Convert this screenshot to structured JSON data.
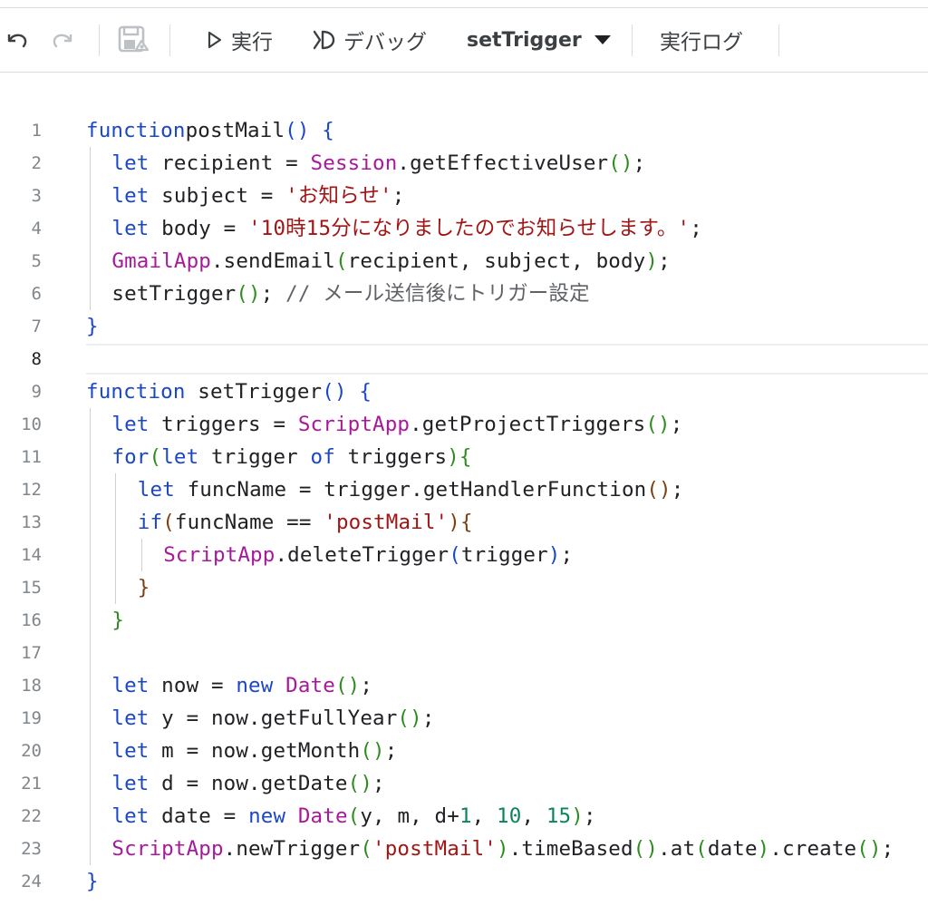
{
  "toolbar": {
    "undo_icon": "undo-icon",
    "redo_icon": "redo-icon",
    "save_icon": "save-icon",
    "run_label": "実行",
    "debug_label": "デバッグ",
    "function_selector": "setTrigger",
    "log_label": "実行ログ"
  },
  "editor": {
    "current_line": 8,
    "lines": [
      {
        "n": "1",
        "indent": 0,
        "tokens": [
          [
            "kw",
            "function"
          ],
          [
            "",
            "postMail"
          ],
          [
            "b0",
            "()"
          ],
          [
            "",
            " "
          ],
          [
            "b0",
            "{"
          ]
        ]
      },
      {
        "n": "2",
        "indent": 1,
        "tokens": [
          [
            "kw",
            "let"
          ],
          [
            "",
            " recipient = "
          ],
          [
            "cls",
            "Session"
          ],
          [
            "",
            ".getEffectiveUser"
          ],
          [
            "b1",
            "()"
          ],
          [
            "",
            ";"
          ]
        ]
      },
      {
        "n": "3",
        "indent": 1,
        "tokens": [
          [
            "kw",
            "let"
          ],
          [
            "",
            " subject = "
          ],
          [
            "str",
            "'お知らせ'"
          ],
          [
            "",
            ";"
          ]
        ]
      },
      {
        "n": "4",
        "indent": 1,
        "tokens": [
          [
            "kw",
            "let"
          ],
          [
            "",
            " body = "
          ],
          [
            "str",
            "'10時15分になりましたのでお知らせします。'"
          ],
          [
            "",
            ";"
          ]
        ]
      },
      {
        "n": "5",
        "indent": 1,
        "tokens": [
          [
            "cls",
            "GmailApp"
          ],
          [
            "",
            ".sendEmail"
          ],
          [
            "b1",
            "("
          ],
          [
            "",
            "recipient, subject, body"
          ],
          [
            "b1",
            ")"
          ],
          [
            "",
            ";"
          ]
        ]
      },
      {
        "n": "6",
        "indent": 1,
        "tokens": [
          [
            "",
            "setTrigger"
          ],
          [
            "b1",
            "()"
          ],
          [
            "",
            "; "
          ],
          [
            "cmt",
            "// メール送信後にトリガー設定"
          ]
        ]
      },
      {
        "n": "7",
        "indent": 0,
        "tokens": [
          [
            "b0",
            "}"
          ]
        ]
      },
      {
        "n": "8",
        "indent": 0,
        "tokens": []
      },
      {
        "n": "9",
        "indent": 0,
        "tokens": [
          [
            "kw",
            "function"
          ],
          [
            "",
            " setTrigger"
          ],
          [
            "b0",
            "()"
          ],
          [
            "",
            " "
          ],
          [
            "b0",
            "{"
          ]
        ]
      },
      {
        "n": "10",
        "indent": 1,
        "tokens": [
          [
            "kw",
            "let"
          ],
          [
            "",
            " triggers = "
          ],
          [
            "cls",
            "ScriptApp"
          ],
          [
            "",
            ".getProjectTriggers"
          ],
          [
            "b1",
            "()"
          ],
          [
            "",
            ";"
          ]
        ]
      },
      {
        "n": "11",
        "indent": 1,
        "tokens": [
          [
            "kw",
            "for"
          ],
          [
            "b1",
            "("
          ],
          [
            "kw",
            "let"
          ],
          [
            "",
            " trigger "
          ],
          [
            "kw",
            "of"
          ],
          [
            "",
            " triggers"
          ],
          [
            "b1",
            ")"
          ],
          [
            "b1",
            "{"
          ]
        ]
      },
      {
        "n": "12",
        "indent": 2,
        "tokens": [
          [
            "kw",
            "let"
          ],
          [
            "",
            " funcName = trigger.getHandlerFunction"
          ],
          [
            "b2",
            "()"
          ],
          [
            "",
            ";"
          ]
        ]
      },
      {
        "n": "13",
        "indent": 2,
        "tokens": [
          [
            "kw",
            "if"
          ],
          [
            "b2",
            "("
          ],
          [
            "",
            "funcName == "
          ],
          [
            "str",
            "'postMail'"
          ],
          [
            "b2",
            ")"
          ],
          [
            "b2",
            "{"
          ]
        ]
      },
      {
        "n": "14",
        "indent": 3,
        "tokens": [
          [
            "cls",
            "ScriptApp"
          ],
          [
            "",
            ".deleteTrigger"
          ],
          [
            "b0",
            "("
          ],
          [
            "",
            "trigger"
          ],
          [
            "b0",
            ")"
          ],
          [
            "",
            ";"
          ]
        ]
      },
      {
        "n": "15",
        "indent": 2,
        "tokens": [
          [
            "b2",
            "}"
          ]
        ]
      },
      {
        "n": "16",
        "indent": 1,
        "tokens": [
          [
            "b1",
            "}"
          ]
        ]
      },
      {
        "n": "17",
        "indent": 1,
        "tokens": []
      },
      {
        "n": "18",
        "indent": 1,
        "tokens": [
          [
            "kw",
            "let"
          ],
          [
            "",
            " now = "
          ],
          [
            "kw",
            "new"
          ],
          [
            "",
            " "
          ],
          [
            "cls",
            "Date"
          ],
          [
            "b1",
            "()"
          ],
          [
            "",
            ";"
          ]
        ]
      },
      {
        "n": "19",
        "indent": 1,
        "tokens": [
          [
            "kw",
            "let"
          ],
          [
            "",
            " y = now.getFullYear"
          ],
          [
            "b1",
            "()"
          ],
          [
            "",
            ";"
          ]
        ]
      },
      {
        "n": "20",
        "indent": 1,
        "tokens": [
          [
            "kw",
            "let"
          ],
          [
            "",
            " m = now.getMonth"
          ],
          [
            "b1",
            "()"
          ],
          [
            "",
            ";"
          ]
        ]
      },
      {
        "n": "21",
        "indent": 1,
        "tokens": [
          [
            "kw",
            "let"
          ],
          [
            "",
            " d = now.getDate"
          ],
          [
            "b1",
            "()"
          ],
          [
            "",
            ";"
          ]
        ]
      },
      {
        "n": "22",
        "indent": 1,
        "tokens": [
          [
            "kw",
            "let"
          ],
          [
            "",
            " date = "
          ],
          [
            "kw",
            "new"
          ],
          [
            "",
            " "
          ],
          [
            "cls",
            "Date"
          ],
          [
            "b1",
            "("
          ],
          [
            "",
            "y, m, d+"
          ],
          [
            "num",
            "1"
          ],
          [
            "",
            ", "
          ],
          [
            "num",
            "10"
          ],
          [
            "",
            ", "
          ],
          [
            "num",
            "15"
          ],
          [
            "b1",
            ")"
          ],
          [
            "",
            ";"
          ]
        ]
      },
      {
        "n": "23",
        "indent": 1,
        "tokens": [
          [
            "cls",
            "ScriptApp"
          ],
          [
            "",
            ".newTrigger"
          ],
          [
            "b1",
            "("
          ],
          [
            "str",
            "'postMail'"
          ],
          [
            "b1",
            ")"
          ],
          [
            "",
            ".timeBased"
          ],
          [
            "b1",
            "()"
          ],
          [
            "",
            ".at"
          ],
          [
            "b1",
            "("
          ],
          [
            "",
            "date"
          ],
          [
            "b1",
            ")"
          ],
          [
            "",
            ".create"
          ],
          [
            "b1",
            "()"
          ],
          [
            "",
            ";"
          ]
        ]
      },
      {
        "n": "24",
        "indent": 0,
        "tokens": [
          [
            "b0",
            "}"
          ]
        ]
      }
    ]
  }
}
